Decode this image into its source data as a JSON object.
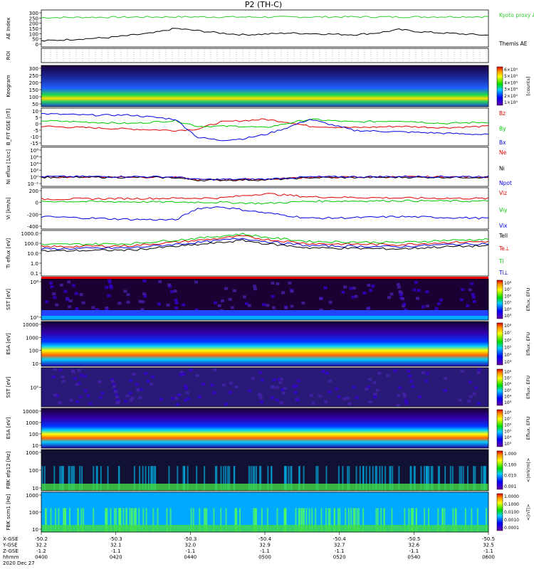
{
  "title": "P2 (TH-C)",
  "colors": {
    "red": "#e00000",
    "green": "#00c800",
    "blue": "#0000e0",
    "black": "#000000",
    "kyoto": "#33cc33"
  },
  "chart_data": {
    "type": "line",
    "x_ticks": [
      "0400",
      "0420",
      "0440",
      "0500",
      "0520",
      "0540",
      "0600"
    ],
    "footer": {
      "row_labels": [
        "X-GSE",
        "Y-GSE",
        "Z-GSE",
        "hhmm",
        "2020 Dec 27"
      ],
      "columns": [
        [
          "-50.2",
          "32.2",
          "-1.2",
          "0400"
        ],
        [
          "-50.3",
          "32.1",
          "-1.1",
          "0420"
        ],
        [
          "-50.3",
          "32.0",
          "-1.1",
          "0440"
        ],
        [
          "-50.4",
          "32.9",
          "-1.1",
          "0500"
        ],
        [
          "-50.4",
          "32.7",
          "-1.1",
          "0520"
        ],
        [
          "-50.5",
          "32.6",
          "-1.1",
          "0540"
        ],
        [
          "-50.5",
          "32.5",
          "-1.1",
          "0600"
        ]
      ]
    },
    "panels": [
      {
        "id": "ae",
        "ylabel": "AE Index",
        "yticks": [
          "300",
          "250",
          "200",
          "150",
          "100",
          "50",
          "0"
        ],
        "ylim": [
          0,
          300
        ],
        "series": [
          {
            "name": "Kyoto proxy AE",
            "color": "#33cc33",
            "x": [
              0,
              0.1,
              0.2,
              0.3,
              0.4,
              0.5,
              0.6,
              0.7,
              0.8,
              0.9,
              1.0
            ],
            "values": [
              245,
              248,
              250,
              252,
              251,
              250,
              251,
              252,
              251,
              253,
              254
            ]
          },
          {
            "name": "Themis AE",
            "color": "#000000",
            "x": [
              0,
              0.05,
              0.1,
              0.15,
              0.2,
              0.25,
              0.3,
              0.35,
              0.4,
              0.45,
              0.5,
              0.55,
              0.6,
              0.65,
              0.7,
              0.75,
              0.8,
              0.85,
              0.9,
              0.95,
              1.0
            ],
            "values": [
              40,
              50,
              60,
              70,
              90,
              110,
              150,
              130,
              110,
              95,
              100,
              110,
              105,
              100,
              95,
              110,
              140,
              120,
              110,
              100,
              90
            ]
          }
        ],
        "legend": [
          "Kyoto proxy AE",
          "Themis AE"
        ]
      },
      {
        "id": "roi",
        "ylabel": "ROI",
        "yticks": [],
        "series": []
      },
      {
        "id": "keogram",
        "ylabel": "Keogram",
        "yticks": [
          "300",
          "250",
          "200",
          "150",
          "100",
          "50"
        ],
        "ylim": [
          0,
          300
        ],
        "colorbar": {
          "label": "[counts]",
          "ticks": [
            "6×10⁴",
            "5×10⁴",
            "4×10⁴",
            "3×10⁴",
            "2×10⁴",
            "1×10⁴"
          ]
        }
      },
      {
        "id": "bfit",
        "ylabel": "B_FIT GSE [nT]",
        "yticks": [
          "10",
          "5",
          "0",
          "-5",
          "-10",
          "-15"
        ],
        "ylim": [
          -15,
          10
        ],
        "series": [
          {
            "name": "Bz",
            "color": "#e00000",
            "x": [
              0,
              0.1,
              0.2,
              0.3,
              0.35,
              0.4,
              0.45,
              0.5,
              0.55,
              0.6,
              0.7,
              0.8,
              0.9,
              1.0
            ],
            "values": [
              -2,
              -3,
              -4,
              -5,
              -4,
              1,
              2,
              3,
              1,
              -2,
              -3,
              -2,
              -3,
              -2
            ]
          },
          {
            "name": "By",
            "color": "#00c800",
            "x": [
              0,
              0.1,
              0.2,
              0.3,
              0.35,
              0.4,
              0.45,
              0.5,
              0.55,
              0.6,
              0.7,
              0.8,
              0.9,
              1.0
            ],
            "values": [
              2,
              1,
              0,
              2,
              -2,
              -2,
              -2,
              -3,
              0,
              3,
              1,
              2,
              0,
              1
            ]
          },
          {
            "name": "Bx",
            "color": "#0000e0",
            "x": [
              0,
              0.1,
              0.2,
              0.3,
              0.35,
              0.4,
              0.45,
              0.5,
              0.55,
              0.6,
              0.7,
              0.8,
              0.9,
              1.0
            ],
            "values": [
              7,
              6,
              6,
              3,
              -10,
              -12,
              -11,
              -8,
              -3,
              3,
              -5,
              -6,
              -7,
              -8
            ]
          }
        ],
        "legend": [
          "Bz",
          "By",
          "Bx"
        ]
      },
      {
        "id": "ni",
        "ylabel": "Ni eflux [1/cc]",
        "yticks": [
          "10⁸",
          "10⁶",
          "10⁴",
          "10²",
          "10⁰",
          "10⁻²"
        ],
        "ylim": [
          -2,
          8
        ],
        "series": [
          {
            "name": "Ne",
            "color": "#e00000",
            "x": [
              0,
              0.2,
              0.3,
              0.35,
              0.5,
              0.6,
              0.8,
              1.0
            ],
            "values": [
              0.2,
              0.2,
              0.1,
              -0.6,
              -0.5,
              0.1,
              0.2,
              0.2
            ]
          },
          {
            "name": "Ni",
            "color": "#000000",
            "x": [
              0,
              0.2,
              0.3,
              0.35,
              0.5,
              0.6,
              0.8,
              1.0
            ],
            "values": [
              0.1,
              0.1,
              0.0,
              -0.7,
              -0.6,
              0.0,
              0.1,
              0.1
            ]
          },
          {
            "name": "Npot",
            "color": "#0000e0",
            "x": [
              0,
              0.2,
              0.3,
              0.35,
              0.5,
              0.6,
              0.8,
              1.0
            ],
            "values": [
              0.3,
              0.3,
              0.2,
              -0.5,
              -0.4,
              0.2,
              0.3,
              0.3
            ]
          }
        ],
        "legend": [
          "Ne",
          "Ni",
          "Npot"
        ]
      },
      {
        "id": "vi",
        "ylabel": "Vi [km/s]",
        "yticks": [
          "200",
          "0",
          "-200",
          "-400"
        ],
        "ylim": [
          -500,
          200
        ],
        "series": [
          {
            "name": "Viz",
            "color": "#e00000",
            "x": [
              0,
              0.2,
              0.4,
              0.5,
              0.6,
              0.8,
              1.0
            ],
            "values": [
              20,
              30,
              40,
              120,
              60,
              40,
              30
            ]
          },
          {
            "name": "Viy",
            "color": "#00c800",
            "x": [
              0,
              0.2,
              0.4,
              0.5,
              0.6,
              0.8,
              1.0
            ],
            "values": [
              -20,
              -30,
              -40,
              -60,
              -20,
              -10,
              -20
            ]
          },
          {
            "name": "Vix",
            "color": "#0000e0",
            "x": [
              0,
              0.2,
              0.3,
              0.35,
              0.4,
              0.5,
              0.6,
              0.7,
              0.8,
              1.0
            ],
            "values": [
              -300,
              -350,
              -360,
              -150,
              -120,
              -230,
              -330,
              -320,
              -300,
              -330
            ]
          }
        ],
        "legend": [
          "Viz",
          "Viy",
          "Vix"
        ]
      },
      {
        "id": "ti",
        "ylabel": "Ti eflux [eV]",
        "yticks": [
          "1000.0",
          "100.0",
          "10.0",
          "1.0",
          "0.1"
        ],
        "ylim": [
          -1,
          3
        ],
        "series": [
          {
            "name": "Te⊥",
            "color": "#e00000",
            "x": [
              0,
              0.2,
              0.35,
              0.45,
              0.5,
              0.6,
              0.8,
              0.9,
              1.0
            ],
            "values": [
              1.6,
              1.7,
              2.2,
              2.6,
              2.3,
              1.9,
              1.8,
              2.0,
              2.1
            ]
          },
          {
            "name": "Ti",
            "color": "#00c800",
            "x": [
              0,
              0.2,
              0.35,
              0.45,
              0.5,
              0.6,
              0.8,
              0.9,
              1.0
            ],
            "values": [
              1.8,
              1.9,
              2.4,
              2.8,
              2.5,
              2.1,
              2.0,
              2.2,
              2.3
            ]
          },
          {
            "name": "Ti⊥",
            "color": "#0000e0",
            "x": [
              0,
              0.2,
              0.35,
              0.45,
              0.5,
              0.6,
              0.8,
              0.9,
              1.0
            ],
            "values": [
              1.4,
              1.5,
              2.0,
              2.4,
              2.1,
              1.7,
              1.6,
              1.8,
              1.9
            ]
          },
          {
            "name": "Tell",
            "color": "#000000",
            "x": [
              0,
              0.2,
              0.35,
              0.45,
              0.5,
              0.6,
              0.8,
              0.9,
              1.0
            ],
            "values": [
              1.2,
              1.3,
              1.8,
              2.2,
              1.9,
              1.5,
              1.4,
              1.6,
              1.7
            ]
          }
        ],
        "legend": [
          "Tell",
          "Te⊥",
          "Ti",
          "Ti⊥"
        ]
      },
      {
        "id": "sst_e",
        "ylabel": "SST [eV]",
        "yticks": [
          "10⁶",
          "10⁵"
        ],
        "colorbar": {
          "label": "Eflux, EFU",
          "ticks": [
            "10⁸",
            "10⁷",
            "10⁶",
            "10⁵",
            "10⁴",
            "10³"
          ]
        }
      },
      {
        "id": "esa_e",
        "ylabel": "ESA [eV]",
        "yticks": [
          "10000",
          "1000",
          "100",
          "10"
        ],
        "colorbar": {
          "label": "Eflux, EFU",
          "ticks": [
            "10⁸",
            "10⁷",
            "10⁶",
            "10⁵",
            "10⁴",
            "10³"
          ]
        }
      },
      {
        "id": "sst_i",
        "ylabel": "SST [eV]",
        "yticks": [
          "10⁵"
        ],
        "colorbar": {
          "label": "Eflux, EFU",
          "ticks": [
            "10⁸",
            "10⁷",
            "10⁶",
            "10⁵",
            "10⁴",
            "10³"
          ]
        }
      },
      {
        "id": "esa_i",
        "ylabel": "ESA [eV]",
        "yticks": [
          "10000",
          "1000",
          "100",
          "10"
        ],
        "colorbar": {
          "label": "Eflux, EFU",
          "ticks": [
            "10⁸",
            "10⁷",
            "10⁶",
            "10⁵",
            "10⁴",
            "10³"
          ]
        }
      },
      {
        "id": "fbk1",
        "ylabel": "FBK efp12 [Hz]",
        "yticks": [
          "1000",
          "100",
          "10"
        ],
        "colorbar": {
          "label": "<|mV/m|>",
          "ticks": [
            "1.000",
            "0.100",
            "0.010",
            "0.001"
          ]
        }
      },
      {
        "id": "fbk2",
        "ylabel": "FBK scm1 [Hz]",
        "yticks": [
          "1000",
          "100",
          "10"
        ],
        "colorbar": {
          "label": "<|nT|>",
          "ticks": [
            "1.0000",
            "0.1000",
            "0.0100",
            "0.0010",
            "0.0001"
          ]
        }
      }
    ]
  }
}
